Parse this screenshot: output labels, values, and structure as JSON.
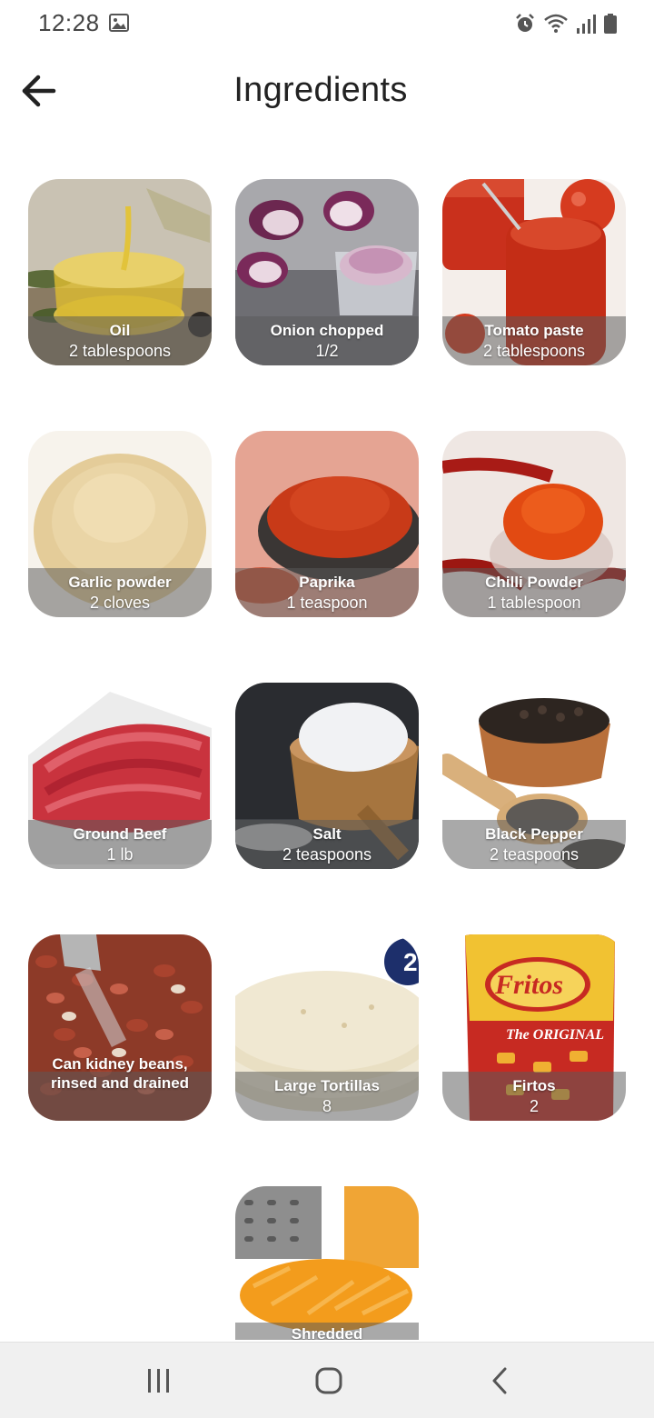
{
  "status_bar": {
    "time": "12:28",
    "icons": [
      "image-icon",
      "alarm-icon",
      "wifi-icon",
      "signal-icon",
      "battery-icon"
    ]
  },
  "header": {
    "back_icon": "arrow-left-icon",
    "title": "Ingredients"
  },
  "ingredients": [
    {
      "name": "Oil",
      "quantity": "2 tablespoons",
      "image": "olive-oil"
    },
    {
      "name": "Onion chopped",
      "quantity": "1/2",
      "image": "onion"
    },
    {
      "name": "Tomato paste",
      "quantity": "2 tablespoons",
      "image": "tomato-paste"
    },
    {
      "name": "Garlic powder",
      "quantity": "2 cloves",
      "image": "garlic-powder"
    },
    {
      "name": "Paprika",
      "quantity": "1 teaspoon",
      "image": "paprika"
    },
    {
      "name": "Chilli Powder",
      "quantity": "1 tablespoon",
      "image": "chilli-powder"
    },
    {
      "name": "Ground Beef",
      "quantity": "1 lb",
      "image": "ground-beef"
    },
    {
      "name": "Salt",
      "quantity": "2 teaspoons",
      "image": "salt"
    },
    {
      "name": "Black Pepper",
      "quantity": "2 teaspoons",
      "image": "black-pepper"
    },
    {
      "name": "Can kidney beans, rinsed and drained",
      "quantity": "",
      "image": "kidney-beans"
    },
    {
      "name": "Large Tortillas",
      "quantity": "8",
      "image": "tortillas"
    },
    {
      "name": "Firtos",
      "quantity": "2",
      "image": "fritos"
    },
    {
      "name": "Shredded",
      "quantity": "",
      "image": "shredded-cheese"
    }
  ],
  "nav_bar": {
    "recents_icon": "recents-icon",
    "home_icon": "home-icon",
    "back_icon": "back-chevron-icon"
  },
  "colors": {
    "label_band": "#5a5a5a",
    "nav_background": "#f0f0f0",
    "text_dark": "#222222"
  }
}
